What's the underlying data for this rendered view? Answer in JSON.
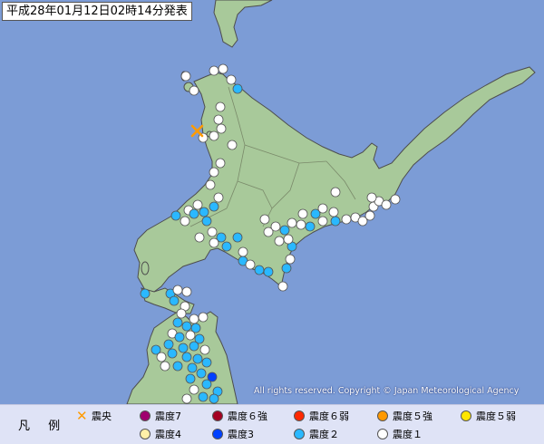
{
  "header": {
    "issued": "平成28年01月12日02時14分発表"
  },
  "copyright": "All rights reserved. Copyright © Japan Meteorological Agency",
  "legend": {
    "title": "凡 例",
    "items": [
      {
        "key": "epicenter",
        "label": "震央",
        "color": "#ff9b00",
        "symbol": "cross"
      },
      {
        "key": "i7",
        "label": "震度7",
        "color": "#a0006e"
      },
      {
        "key": "i6p",
        "label": "震度６強",
        "color": "#a40021"
      },
      {
        "key": "i6m",
        "label": "震度６弱",
        "color": "#ff2800"
      },
      {
        "key": "i5p",
        "label": "震度５強",
        "color": "#ff9900"
      },
      {
        "key": "i5m",
        "label": "震度５弱",
        "color": "#ffe600"
      },
      {
        "key": "i4",
        "label": "震度4",
        "color": "#fff0a8"
      },
      {
        "key": "i3",
        "label": "震度3",
        "color": "#0041ff"
      },
      {
        "key": "i2",
        "label": "震度２",
        "color": "#2ab8ff"
      },
      {
        "key": "i1",
        "label": "震度１",
        "color": "#ffffff"
      }
    ]
  },
  "colors": {
    "sea": "#7c9cd6",
    "land": "#a8c99a",
    "coast": "#4d4d4d",
    "boundary": "#7a8a6a"
  }
}
